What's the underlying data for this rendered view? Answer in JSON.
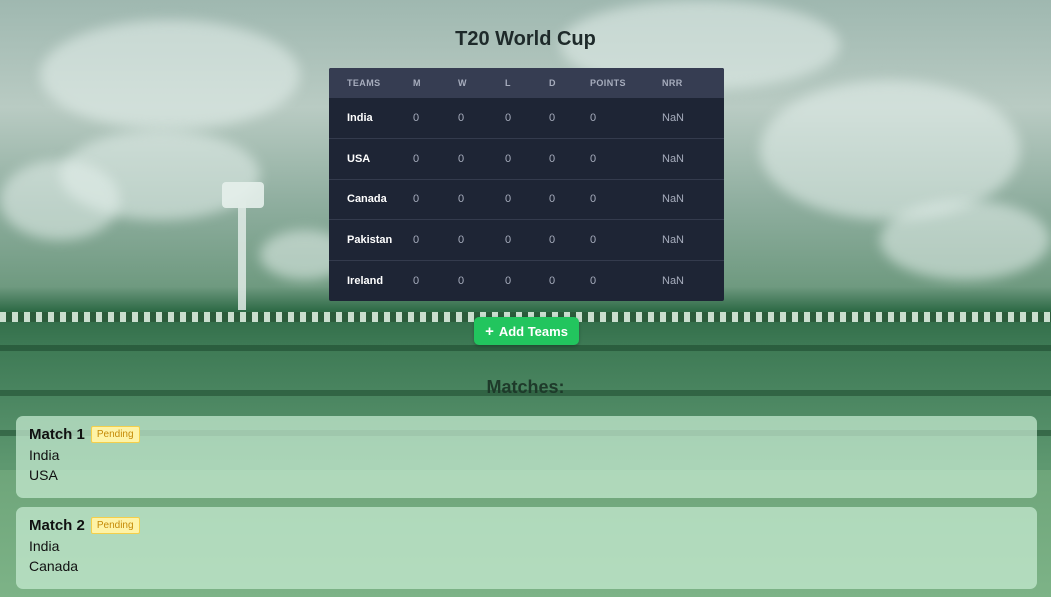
{
  "app": {
    "title": "T20 World Cup"
  },
  "table": {
    "headers": [
      "TEAMS",
      "M",
      "W",
      "L",
      "D",
      "POINTS",
      "NRR"
    ],
    "rows": [
      {
        "team": "India",
        "m": "0",
        "w": "0",
        "l": "0",
        "d": "0",
        "points": "0",
        "nrr": "NaN"
      },
      {
        "team": "USA",
        "m": "0",
        "w": "0",
        "l": "0",
        "d": "0",
        "points": "0",
        "nrr": "NaN"
      },
      {
        "team": "Canada",
        "m": "0",
        "w": "0",
        "l": "0",
        "d": "0",
        "points": "0",
        "nrr": "NaN"
      },
      {
        "team": "Pakistan",
        "m": "0",
        "w": "0",
        "l": "0",
        "d": "0",
        "points": "0",
        "nrr": "NaN"
      },
      {
        "team": "Ireland",
        "m": "0",
        "w": "0",
        "l": "0",
        "d": "0",
        "points": "0",
        "nrr": "NaN"
      }
    ]
  },
  "add_button": {
    "icon": "plus-icon",
    "label": "Add Teams",
    "color": "#22c55e"
  },
  "matches": {
    "heading": "Matches:",
    "items": [
      {
        "name": "Match 1",
        "status": "Pending",
        "team1": "India",
        "team2": "USA"
      },
      {
        "name": "Match 2",
        "status": "Pending",
        "team1": "India",
        "team2": "Canada"
      }
    ]
  }
}
